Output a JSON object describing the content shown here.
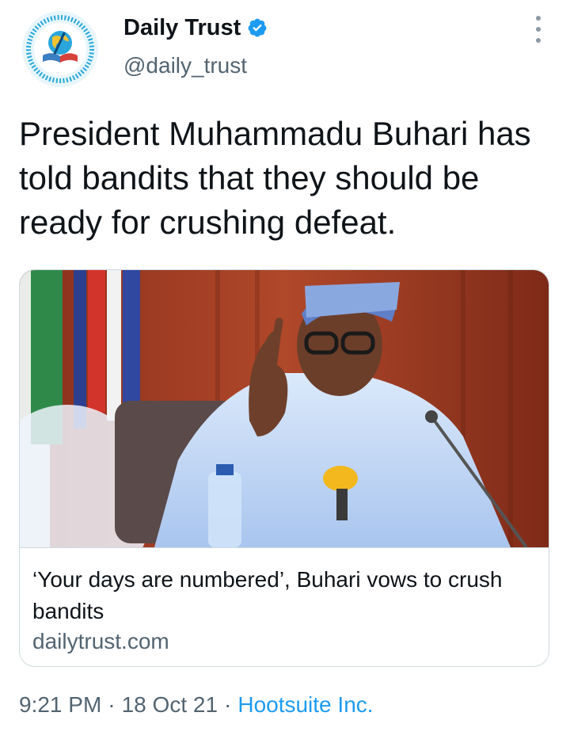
{
  "account": {
    "name": "Daily Trust",
    "handle": "@daily_trust",
    "verified": true
  },
  "tweet": {
    "text": "President Muhammadu Buhari has told bandits that they should be ready for crushing defeat."
  },
  "link_card": {
    "title": "‘Your days are numbered’, Buhari vows to crush bandits",
    "domain": "dailytrust.com"
  },
  "meta": {
    "time": "9:21 PM",
    "separator": "·",
    "date": "18 Oct 21",
    "source": "Hootsuite Inc."
  },
  "colors": {
    "verified_badge": "#1d9bf0",
    "source_link": "#1d9bf0",
    "secondary_text": "#536471"
  },
  "icons": [
    "daily-trust-logo-icon",
    "verified-badge-icon",
    "more-options-icon"
  ]
}
